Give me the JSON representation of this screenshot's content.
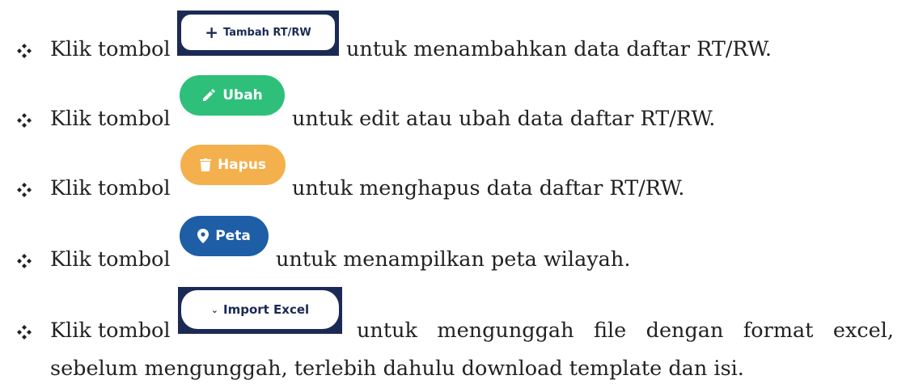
{
  "items": [
    {
      "prefix": "Klik tombol",
      "button_label": "Tambah RT/RW",
      "suffix": "untuk menambahkan data daftar RT/RW.",
      "icon": "plus-icon",
      "color": "#1b2a55"
    },
    {
      "prefix": "Klik tombol",
      "button_label": "Ubah",
      "suffix": "untuk edit atau ubah data daftar RT/RW.",
      "icon": "pencil-icon",
      "color": "#2ec07a"
    },
    {
      "prefix": "Klik tombol",
      "button_label": "Hapus",
      "suffix": "untuk menghapus data daftar RT/RW.",
      "icon": "trash-icon",
      "color": "#f4b04d"
    },
    {
      "prefix": "Klik tombol",
      "button_label": "Peta",
      "suffix": "untuk menampilkan peta wilayah.",
      "icon": "map-pin-icon",
      "color": "#1d5ea6"
    },
    {
      "prefix": "Klik tombol",
      "button_label": "Import Excel",
      "suffix": "untuk mengunggah file dengan format excel,",
      "suffix_line2": "sebelum mengunggah, terlebih dahulu download template dan isi.",
      "icon": "chevron-down-icon",
      "color": "#1b2a55"
    }
  ]
}
